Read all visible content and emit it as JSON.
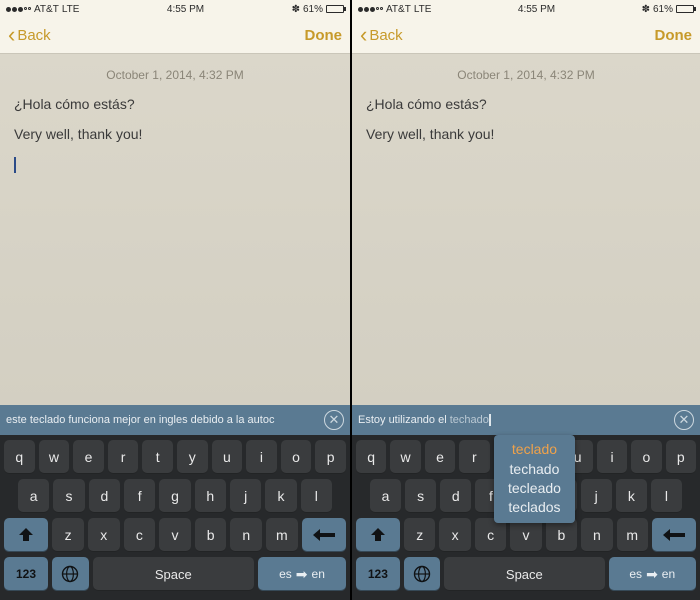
{
  "status": {
    "carrier": "AT&T",
    "net": "LTE",
    "time": "4:55 PM",
    "batt": "61%"
  },
  "nav": {
    "back": "Back",
    "done": "Done"
  },
  "note": {
    "timestamp": "October 1, 2014, 4:32 PM",
    "line1": "¿Hola cómo estás?",
    "line2": "Very well, thank you!"
  },
  "left": {
    "inputbar": "este teclado funciona mejor en ingles debido a la autoc"
  },
  "right": {
    "inputbar_prefix": "Estoy utilizando el ",
    "inputbar_ghost": "techado",
    "suggestions": {
      "sel": "teclado",
      "o1": "techado",
      "o2": "tecleado",
      "o3": "teclados"
    }
  },
  "keys": {
    "row1": [
      "q",
      "w",
      "e",
      "r",
      "t",
      "y",
      "u",
      "i",
      "o",
      "p"
    ],
    "row2": [
      "a",
      "s",
      "d",
      "f",
      "g",
      "h",
      "j",
      "k",
      "l"
    ],
    "row3": [
      "z",
      "x",
      "c",
      "v",
      "b",
      "n",
      "m"
    ],
    "n123": "123",
    "space": "Space",
    "lang_from": "es",
    "lang_to": "en"
  }
}
